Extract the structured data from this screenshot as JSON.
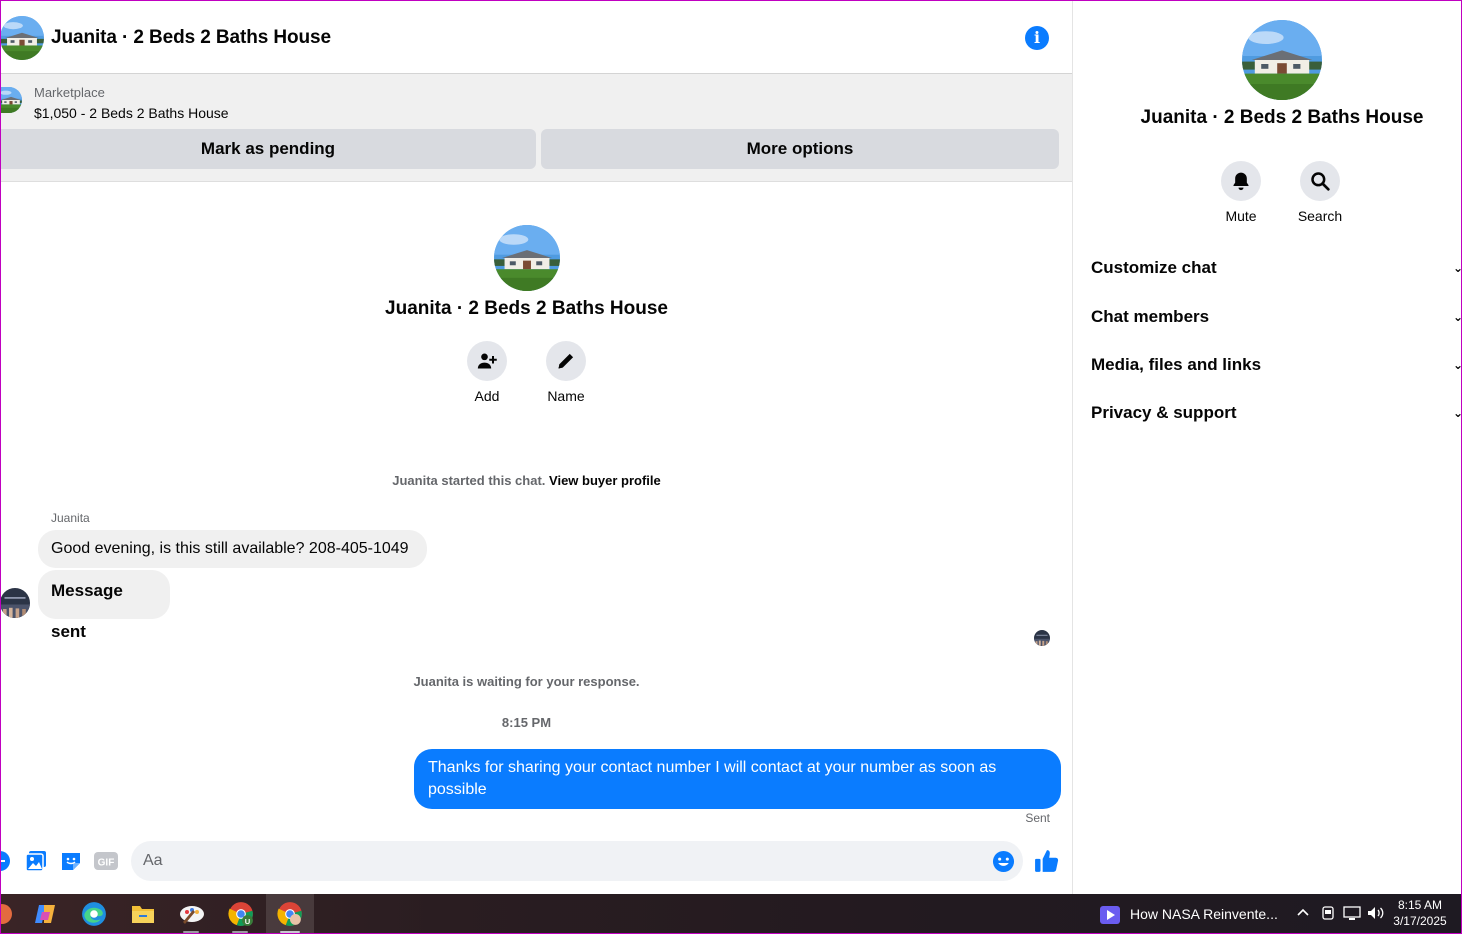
{
  "header": {
    "title": "Juanita · 2 Beds 2 Baths House",
    "info_icon": "info-icon"
  },
  "marketplace": {
    "label": "Marketplace",
    "listing": "$1,050 - 2 Beds 2 Baths House",
    "mark_pending": "Mark as pending",
    "more_options": "More options"
  },
  "intro": {
    "title": "Juanita · 2 Beds 2 Baths House",
    "add_label": "Add",
    "name_label": "Name"
  },
  "system": {
    "started_prefix": "Juanita started this chat.",
    "buyer_profile_link": "View buyer profile",
    "waiting": "Juanita is waiting for your response.",
    "timestamp": "8:15 PM"
  },
  "messages": {
    "sender": "Juanita",
    "incoming": [
      "Good evening, is this still available? 208-405-1049",
      "Message sent"
    ],
    "outgoing": "Thanks for sharing your contact number I will contact at your number as soon as possible",
    "sent_status": "Sent"
  },
  "composer": {
    "placeholder": "Aa",
    "gif_label": "GIF"
  },
  "right_panel": {
    "title": "Juanita · 2 Beds 2 Baths House",
    "mute_label": "Mute",
    "search_label": "Search",
    "sections": [
      "Customize chat",
      "Chat members",
      "Media, files and links",
      "Privacy & support"
    ]
  },
  "taskbar": {
    "media_title": "How NASA Reinvente...",
    "time": "8:15 AM",
    "date": "3/17/2025"
  },
  "colors": {
    "accent": "#0a7cff",
    "bubble_in": "#f0f0f0",
    "panel_bg": "#f0f0f0"
  }
}
